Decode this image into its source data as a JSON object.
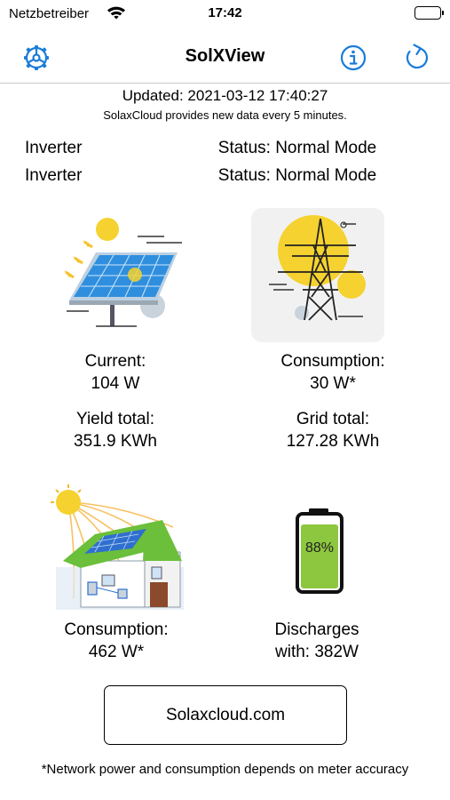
{
  "status_bar": {
    "carrier": "Netzbetreiber",
    "time": "17:42"
  },
  "nav": {
    "title": "SolXView"
  },
  "header": {
    "updated": "Updated: 2021-03-12 17:40:27",
    "note": "SolaxCloud provides new data every 5 minutes."
  },
  "inverters": [
    {
      "label": "Inverter",
      "status": "Status: Normal Mode"
    },
    {
      "label": "Inverter",
      "status": "Status: Normal Mode"
    }
  ],
  "solar": {
    "current_label": "Current:",
    "current_value": "104 W",
    "yield_label": "Yield total:",
    "yield_value": "351.9 KWh"
  },
  "grid": {
    "consumption_label": "Consumption:",
    "consumption_value": "30 W*",
    "total_label": "Grid total:",
    "total_value": "127.28 KWh"
  },
  "house": {
    "consumption_label": "Consumption:",
    "consumption_value": "462 W*"
  },
  "battery": {
    "percent": "88%",
    "level": 0.88,
    "label_line1": "Discharges",
    "label_line2": "with: 382W"
  },
  "link": {
    "label": "Solaxcloud.com"
  },
  "footnote": "*Network power and consumption depends on meter accuracy",
  "colors": {
    "accent": "#1a7cd9",
    "battery_green": "#8dc63f",
    "sun_yellow": "#f5d22f"
  }
}
